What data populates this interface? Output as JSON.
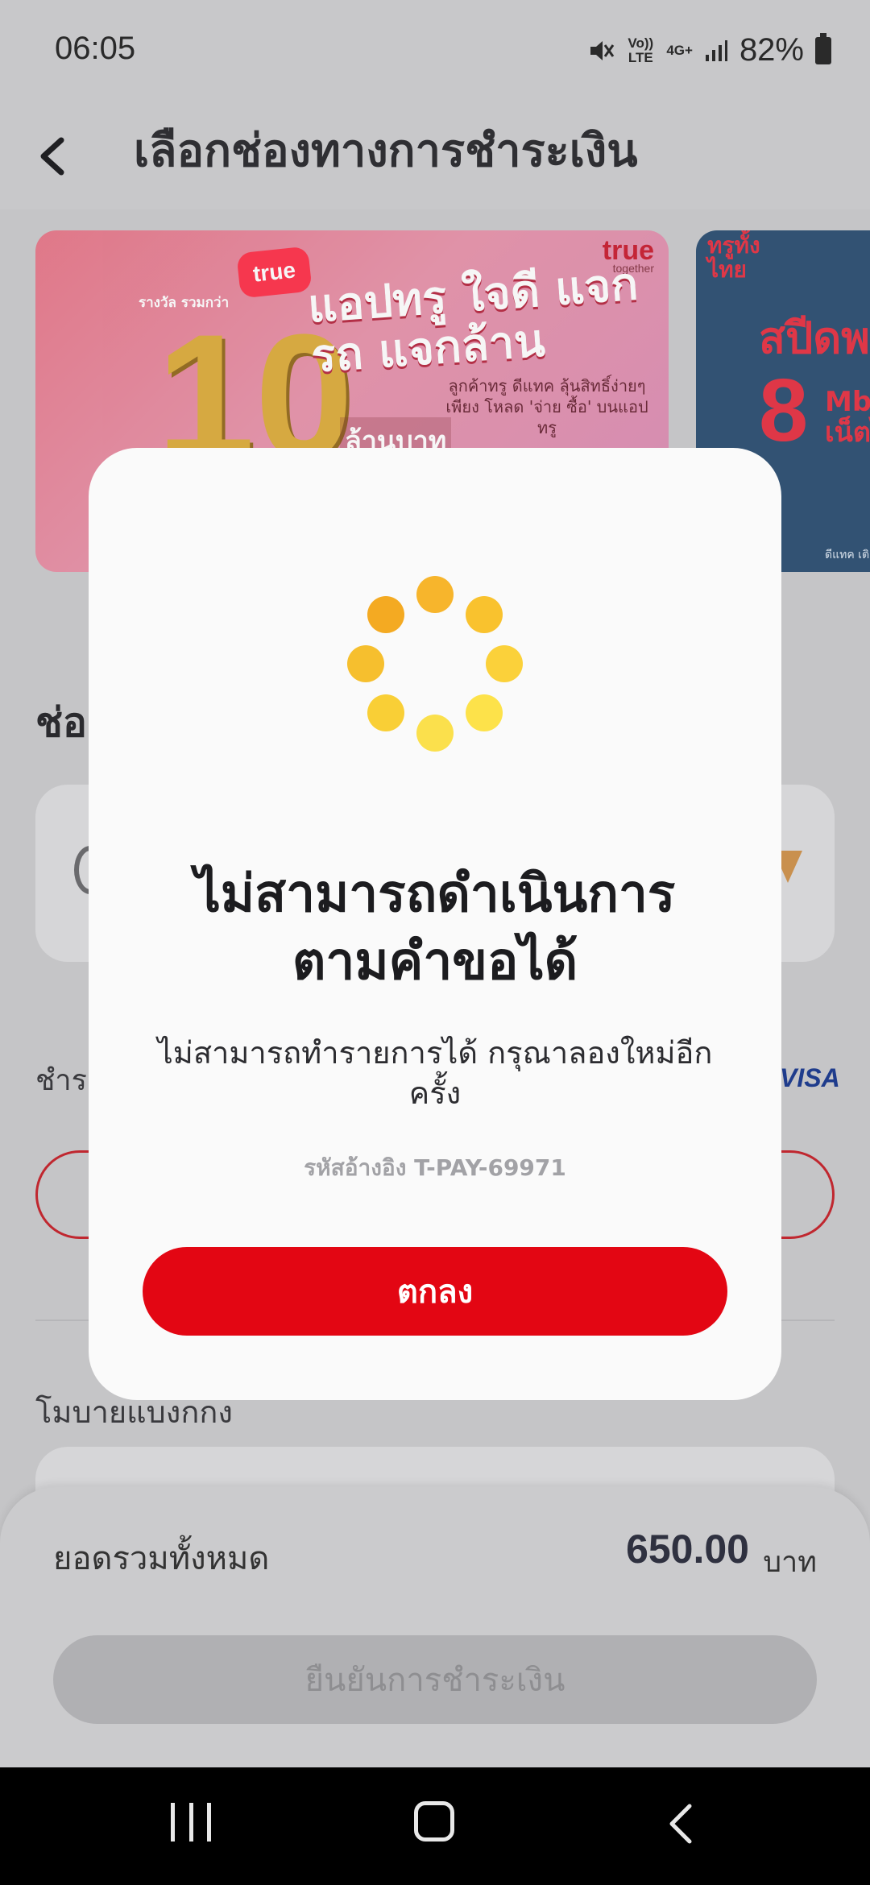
{
  "status": {
    "time": "06:05",
    "volte": "Vo)) LTE",
    "network": "4G+",
    "battery": "82%"
  },
  "header": {
    "title": "เลือกช่องทางการชำระเงิน"
  },
  "banners": [
    {
      "brand": "true",
      "brand_sub": "together",
      "chip": "true",
      "headline": "แอปทรู ใจดี แจกรถ แจกล้าน",
      "big_number": "10",
      "unit": "ล้านบาท",
      "prize_label": "รางวัล รวมกว่า",
      "subtext": "ลูกค้าทรู ดีแทค ลุ้นสิทธิ์ง่ายๆ เพียง โหลด 'จ่าย ซื้อ' บนแอปทรู"
    },
    {
      "logo": "ทรูทั้ง ไทย",
      "headline": "สปีดพ",
      "number": "8",
      "unit": "Mb เน็ตไ",
      "footnote": "ดีแทค เติ"
    }
  ],
  "section": {
    "title_partial": "ช่อ",
    "pay_label_partial": "ชำร",
    "visa": "VISA",
    "mobile_label": "โมบายแบงกกง"
  },
  "summary": {
    "total_label": "ยอดรวมทั้งหมด",
    "total_amount": "650.00",
    "currency": "บาท",
    "confirm_label": "ยืนยันการชำระเงิน"
  },
  "dialog": {
    "title_line1": "ไม่สามารถดำเนินการ",
    "title_line2": "ตามคำขอได้",
    "message": "ไม่สามารถทำรายการได้ กรุณาลองใหม่อีกครั้ง",
    "reference": "รหัสอ้างอิง T-PAY-69971",
    "ok_label": "ตกลง",
    "spinner_colors": [
      "#f7b52c",
      "#f9c22e",
      "#fbd13a",
      "#fde24a",
      "#fbe04c",
      "#f9cf36",
      "#f6bf2e",
      "#f4aa22"
    ]
  },
  "colors": {
    "primary_red": "#e30613",
    "overlay": "#c5c5c7"
  }
}
